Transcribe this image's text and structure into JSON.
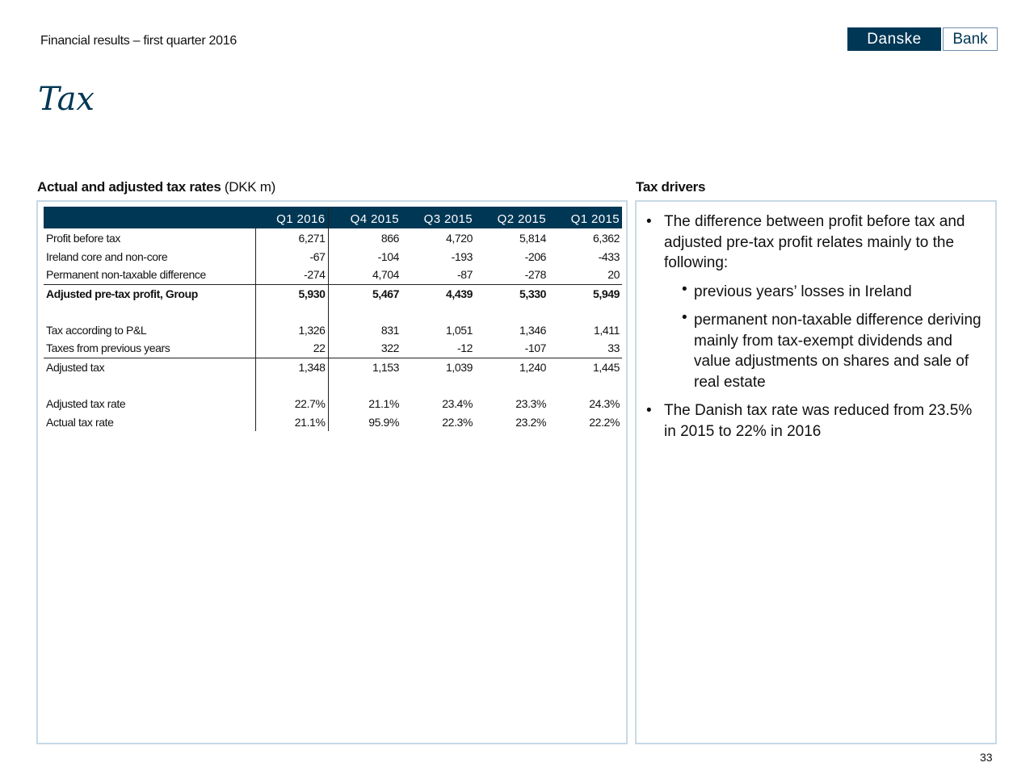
{
  "header": {
    "title": "Financial results – first quarter 2016",
    "logo_left": "Danske",
    "logo_right": "Bank"
  },
  "page_title": "Tax",
  "left_section": {
    "heading_bold": "Actual and adjusted tax rates",
    "heading_rest": " (DKK m)"
  },
  "right_section": {
    "heading": "Tax drivers"
  },
  "table": {
    "columns": [
      "Q1 2016",
      "Q4 2015",
      "Q3 2015",
      "Q2 2015",
      "Q1 2015"
    ],
    "rows": [
      {
        "label": "Profit before tax",
        "values": [
          "6,271",
          "866",
          "4,720",
          "5,814",
          "6,362"
        ]
      },
      {
        "label": "Ireland core and non-core",
        "values": [
          "-67",
          "-104",
          "-193",
          "-206",
          "-433"
        ]
      },
      {
        "label": "Permanent non-taxable difference",
        "values": [
          "-274",
          "4,704",
          "-87",
          "-278",
          "20"
        ]
      },
      {
        "label": "Adjusted pre-tax profit, Group",
        "values": [
          "5,930",
          "5,467",
          "4,439",
          "5,330",
          "5,949"
        ]
      },
      {
        "label": "Tax according to P&L",
        "values": [
          "1,326",
          "831",
          "1,051",
          "1,346",
          "1,411"
        ]
      },
      {
        "label": "Taxes from previous years",
        "values": [
          "22",
          "322",
          "-12",
          "-107",
          "33"
        ]
      },
      {
        "label": "Adjusted tax",
        "values": [
          "1,348",
          "1,153",
          "1,039",
          "1,240",
          "1,445"
        ]
      },
      {
        "label": "Adjusted tax rate",
        "values": [
          "22.7%",
          "21.1%",
          "23.4%",
          "23.3%",
          "24.3%"
        ]
      },
      {
        "label": "Actual tax rate",
        "values": [
          "21.1%",
          "95.9%",
          "22.3%",
          "23.2%",
          "22.2%"
        ]
      }
    ]
  },
  "drivers": {
    "bullet1": "The difference between profit before tax and adjusted pre-tax profit relates mainly to the following:",
    "sub1": "previous years’ losses in Ireland",
    "sub2": "permanent non-taxable difference deriving mainly from tax-exempt dividends and value adjustments on shares and sale of real estate",
    "bullet2": "The Danish tax rate was reduced from 23.5% in 2015 to 22% in 2016"
  },
  "page_number": "33"
}
